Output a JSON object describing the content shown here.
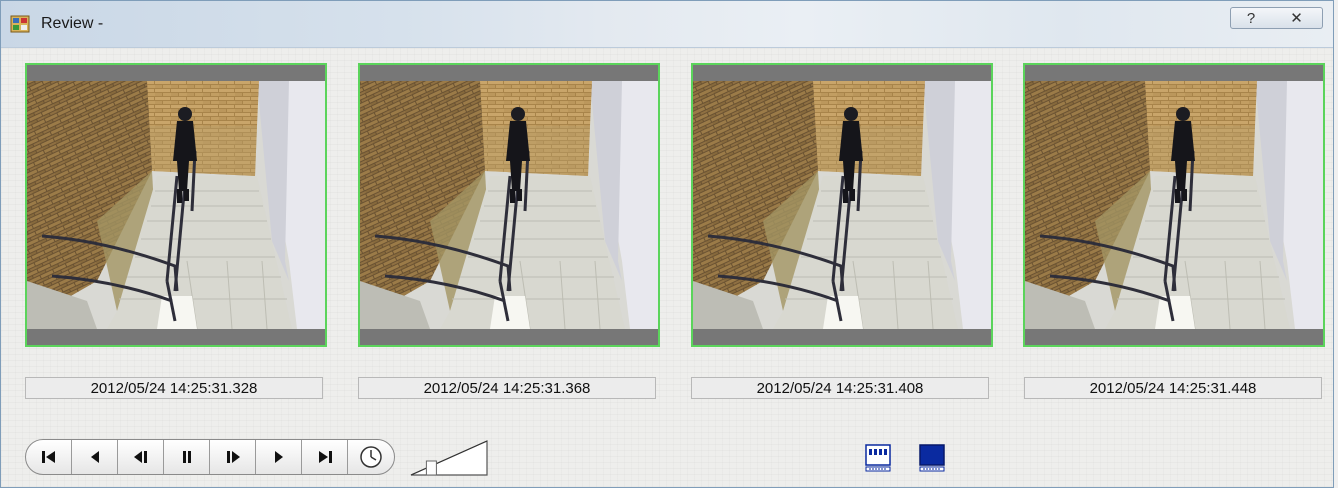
{
  "window": {
    "title": "Review -",
    "help_label": "?",
    "close_label": "✕"
  },
  "frames": [
    {
      "timestamp": "2012/05/24 14:25:31.328"
    },
    {
      "timestamp": "2012/05/24 14:25:31.368"
    },
    {
      "timestamp": "2012/05/24 14:25:31.408"
    },
    {
      "timestamp": "2012/05/24 14:25:31.448"
    }
  ],
  "frame_border_color": "#5bd45b",
  "controls": {
    "transport_icons": [
      "skip-to-start-icon",
      "step-back-icon",
      "frame-back-icon",
      "pause-icon",
      "frame-forward-icon",
      "play-icon",
      "skip-to-end-icon",
      "clock-icon"
    ],
    "speed_slider_level": 0.15,
    "view_buttons": [
      "multi-frame-view-icon",
      "single-frame-view-icon"
    ]
  }
}
